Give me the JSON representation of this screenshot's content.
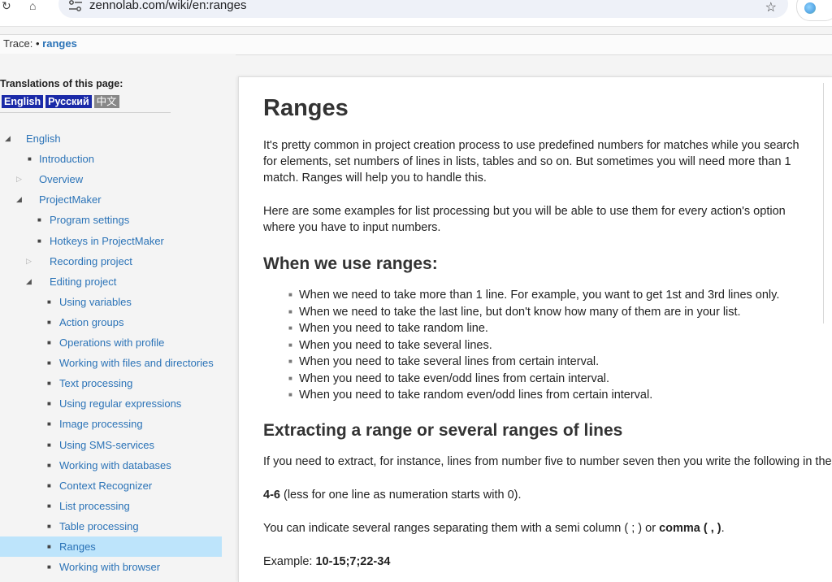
{
  "browser": {
    "url": "zennolab.com/wiki/en:ranges",
    "icons": [
      "reload-icon",
      "home-icon",
      "tune-icon",
      "star-icon",
      "profile-icon"
    ]
  },
  "trace": {
    "label": "Trace:",
    "bullet": "•",
    "link": "ranges"
  },
  "sidebar": {
    "translations_title": "Translations of this page:",
    "languages": [
      "English",
      "Русский",
      "中文"
    ],
    "nav": [
      {
        "label": "English",
        "marker": "open",
        "level": 0
      },
      {
        "label": "Introduction",
        "marker": "leaf",
        "level": 1
      },
      {
        "label": "Overview",
        "marker": "closed",
        "level": 1
      },
      {
        "label": "ProjectMaker",
        "marker": "open",
        "level": 1
      },
      {
        "label": "Program settings",
        "marker": "leaf",
        "level": 2
      },
      {
        "label": "Hotkeys in ProjectMaker",
        "marker": "leaf",
        "level": 2
      },
      {
        "label": "Recording project",
        "marker": "closed",
        "level": 2
      },
      {
        "label": "Editing project",
        "marker": "open",
        "level": 2
      },
      {
        "label": "Using variables",
        "marker": "leaf",
        "level": 3
      },
      {
        "label": "Action groups",
        "marker": "leaf",
        "level": 3
      },
      {
        "label": "Operations with profile",
        "marker": "leaf",
        "level": 3
      },
      {
        "label": "Working with files and directories",
        "marker": "leaf",
        "level": 3
      },
      {
        "label": "Text processing",
        "marker": "leaf",
        "level": 3
      },
      {
        "label": "Using regular expressions",
        "marker": "leaf",
        "level": 3
      },
      {
        "label": "Image processing",
        "marker": "leaf",
        "level": 3
      },
      {
        "label": "Using SMS-services",
        "marker": "leaf",
        "level": 3
      },
      {
        "label": "Working with databases",
        "marker": "leaf",
        "level": 3
      },
      {
        "label": "Context Recognizer",
        "marker": "leaf",
        "level": 3
      },
      {
        "label": "List processing",
        "marker": "leaf",
        "level": 3
      },
      {
        "label": "Table processing",
        "marker": "leaf",
        "level": 3
      },
      {
        "label": "Ranges",
        "marker": "leaf",
        "level": 3,
        "active": true
      },
      {
        "label": "Working with browser",
        "marker": "leaf",
        "level": 3
      }
    ]
  },
  "content": {
    "title": "Ranges",
    "intro_lines": [
      "It's pretty common in project creation process to use predefined numbers for matches while you search",
      "for elements, set numbers of lines in lists, tables and so on. But sometimes you will need more than 1",
      "match. Ranges will help you to handle this."
    ],
    "examples_lines": [
      "Here are some examples for list processing but you will be able to use them for every action's option",
      "where you have to input numbers."
    ],
    "h2_when": "When we use ranges:",
    "bullets": [
      "When we need to take more than 1 line. For example, you want to get 1st and 3rd lines only.",
      "When we need to take the last line, but don't know how many of them are in your list.",
      "When you need to take random line.",
      "When you need to take several lines.",
      "When you need to take several lines from certain interval.",
      "When you need to take even/odd lines from certain interval.",
      "When you need to take random even/odd lines from certain interval."
    ],
    "h2_extract": "Extracting a range or several ranges of lines",
    "extract_text": "If you need to extract, for instance, lines from number five to number seven then you write the following in the",
    "range_example_bold": "4-6",
    "range_example_rest": " (less for one line as numeration starts with 0).",
    "several_text": "You can indicate several ranges separating them with a semi column ( ; ) or ",
    "several_bold": "comma ( , )",
    "several_end": ".",
    "example_label": "Example: ",
    "example_value": "10-15;7;22-34"
  }
}
